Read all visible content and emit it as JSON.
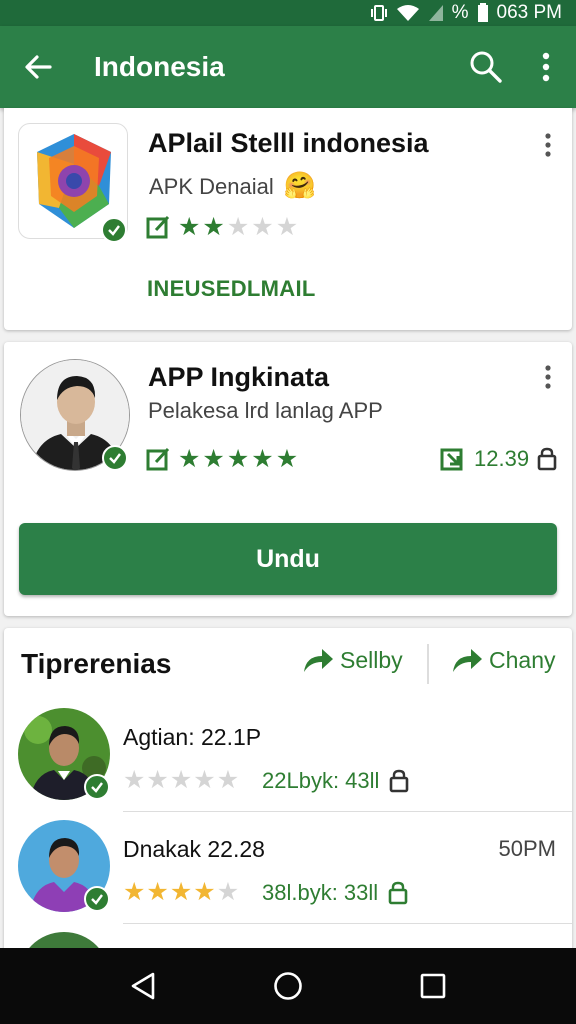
{
  "status_bar": {
    "battery_label": "%",
    "time": "063 PM"
  },
  "app_bar": {
    "title": "Indonesia",
    "icons": [
      "back-arrow-icon",
      "search-icon",
      "more-vertical-icon"
    ]
  },
  "featured_app": {
    "name": "APlail Stelll indonesia",
    "subtitle": "APK Denaial",
    "emoji": "🤗",
    "rating": 2,
    "rating_max": 5,
    "link_label": "INEUSEDLMAIL",
    "icon": "app-logo-icon"
  },
  "developer_app": {
    "name": "APP Ingkinata",
    "subtitle": "Pelakesa lrd lanlag APP",
    "rating": 5,
    "rating_max": 5,
    "size": "12.39",
    "download_label": "Undu"
  },
  "reviews_section": {
    "title": "Tiprerenias",
    "actions": [
      {
        "label": "Sellby",
        "icon": "share-arrow-icon"
      },
      {
        "label": "Chany",
        "icon": "share-arrow-icon"
      }
    ],
    "reviews": [
      {
        "name": "Agtian: 22.1P",
        "time": "",
        "rating": 0,
        "rating_max": 5,
        "meta": "22Lbyk: 43ll"
      },
      {
        "name": "Dnakak 22.28",
        "time": "50PM",
        "rating": 4,
        "rating_max": 5,
        "meta": "38l.byk: 33ll"
      },
      {
        "name": "",
        "time": "",
        "rating": 0,
        "rating_max": 5,
        "meta": ""
      }
    ]
  },
  "colors": {
    "primary": "#2c8048",
    "status_bar": "#1f6a3a",
    "accent_green": "#2e7d32",
    "star_gold": "#f2b632"
  }
}
